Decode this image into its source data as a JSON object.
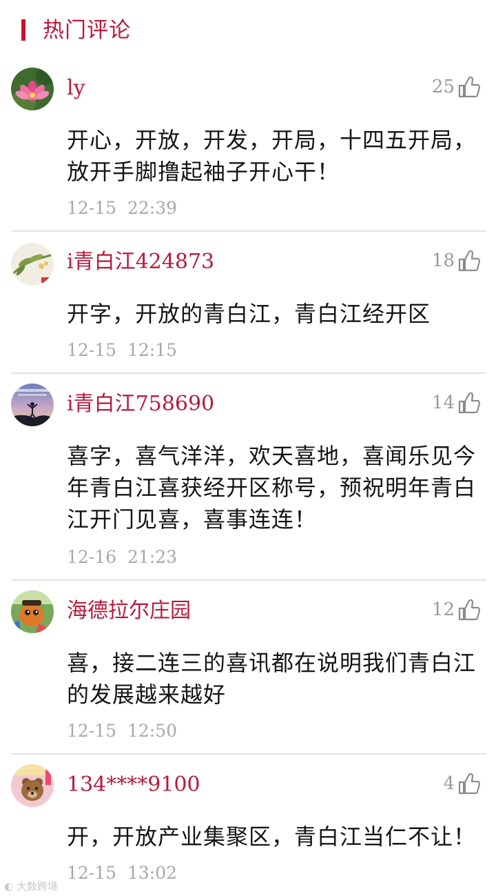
{
  "section": {
    "title": "热门评论"
  },
  "comments": [
    {
      "user": "ly",
      "likes": "25",
      "content": "开心，开放，开发，开局，十四五开局，放开手脚撸起袖子开心干！",
      "time": "12-15  22:39"
    },
    {
      "user": "i青白江424873",
      "likes": "18",
      "content": "开字，开放的青白江，青白江经开区",
      "time": "12-15  12:15"
    },
    {
      "user": "i青白江758690",
      "likes": "14",
      "content": "喜字，喜气洋洋，欢天喜地，喜闻乐见今年青白江喜获经开区称号，预祝明年青白江开门见喜，喜事连连！",
      "time": "12-16  21:23"
    },
    {
      "user": "海德拉尔庄园",
      "likes": "12",
      "content": "喜，接二连三的喜讯都在说明我们青白江的发展越来越好",
      "time": "12-15  12:50"
    },
    {
      "user": "134****9100",
      "likes": "4",
      "content": "开，开放产业集聚区，青白江当仁不让！",
      "time": "12-15  13:02"
    }
  ],
  "watermark": "大数跨境",
  "colors": {
    "accent": "#b8193a",
    "bar": "#c8102e",
    "text": "#141414",
    "muted": "#a8a8a8",
    "divider": "#e2e2e2"
  }
}
